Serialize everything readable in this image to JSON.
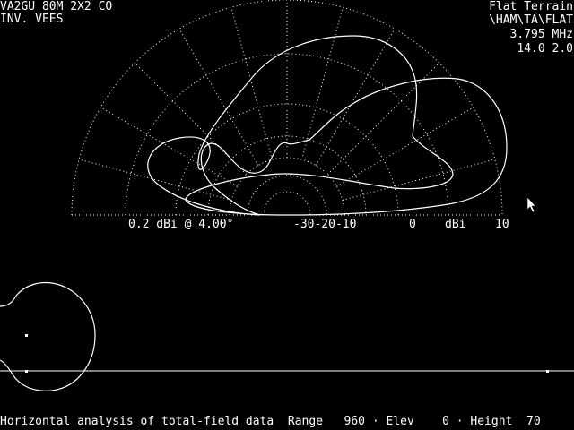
{
  "header_left": {
    "line1": "VA2GU 80M 2X2 CO",
    "line2": "INV. VEES"
  },
  "header_right": {
    "line1": "Flat Terrain",
    "line2": "\\HAM\\TA\\FLAT",
    "line3": "3.795 MHz",
    "line4": "14.0 2.0"
  },
  "polar_plot": {
    "peak_label": "0.2 dBi @ 4.00°",
    "scale_labels": "-30-20-10",
    "zero_label": "0",
    "unit_label": "dBi",
    "max_label": "10"
  },
  "status_bar": {
    "text": "Horizontal analysis of total-field data  Range   960 · Elev    0 · Height  70"
  },
  "colors": {
    "background": "#000000",
    "foreground": "#ffffff"
  },
  "icons": {
    "cursor": "mouse-pointer-icon"
  }
}
